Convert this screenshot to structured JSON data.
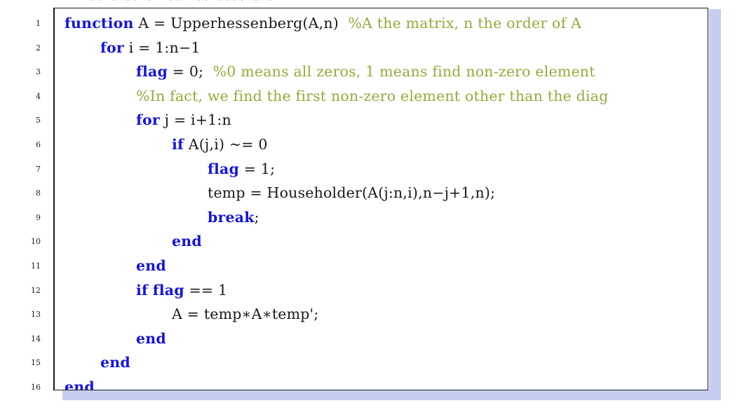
{
  "page": {
    "kind": "latex-code-listing",
    "language": "MATLAB",
    "clipped_top_text": ". , ; . , . , ; . , . . , ; . . , , . , , ; , . , . ,"
  },
  "colors": {
    "keyword": "#1414e0",
    "comment": "#9aa83c",
    "identifier": "#1a1a1a",
    "frame_border": "#1b1b1b",
    "shadow": "#c6cdf0",
    "background": "#ffffff"
  },
  "listing": {
    "line_numbers": [
      "1",
      "2",
      "3",
      "4",
      "5",
      "6",
      "7",
      "8",
      "9",
      "10",
      "11",
      "12",
      "13",
      "14",
      "15",
      "16"
    ],
    "lines": [
      {
        "number": "1",
        "indent": 0,
        "text": "function A = Upperhessenberg(A,n)  %A the matrix, n the order of A",
        "tokens": [
          {
            "t": "function",
            "k": "kw"
          },
          {
            "t": " A = Upperhessenberg(A,n)  ",
            "k": "id"
          },
          {
            "t": "%A the matrix, n the order of A",
            "k": "cm"
          }
        ]
      },
      {
        "number": "2",
        "indent": 2,
        "text": "for i = 1:n-1",
        "tokens": [
          {
            "t": "for",
            "k": "kw"
          },
          {
            "t": " i = 1:n−1",
            "k": "id"
          }
        ]
      },
      {
        "number": "3",
        "indent": 4,
        "text": "flag = 0;  %0 means all zeros, 1 means find non-zero element",
        "tokens": [
          {
            "t": "flag",
            "k": "kw"
          },
          {
            "t": " = 0;  ",
            "k": "id"
          },
          {
            "t": "%0 means all zeros, 1 means find non-zero element",
            "k": "cm"
          }
        ]
      },
      {
        "number": "4",
        "indent": 4,
        "text": "%In fact, we find the first non-zero element other than the diag",
        "tokens": [
          {
            "t": "%In fact, we find the first non-zero element other than the diag",
            "k": "cm"
          }
        ]
      },
      {
        "number": "5",
        "indent": 4,
        "text": "for j = i+1:n",
        "tokens": [
          {
            "t": "for",
            "k": "kw"
          },
          {
            "t": " j = i+1:n",
            "k": "id"
          }
        ]
      },
      {
        "number": "6",
        "indent": 6,
        "text": "if A(j,i) ~= 0",
        "tokens": [
          {
            "t": "if",
            "k": "kw"
          },
          {
            "t": " A(j,i) ~= 0",
            "k": "id"
          }
        ]
      },
      {
        "number": "7",
        "indent": 8,
        "text": "flag = 1;",
        "tokens": [
          {
            "t": "flag",
            "k": "kw"
          },
          {
            "t": " = 1;",
            "k": "id"
          }
        ]
      },
      {
        "number": "8",
        "indent": 8,
        "text": "temp = Householder(A(j:n,i),n-j+1,n);",
        "tokens": [
          {
            "t": "temp = Householder(A(j:n,i),n−j+1,n);",
            "k": "id"
          }
        ]
      },
      {
        "number": "9",
        "indent": 8,
        "text": "break;",
        "tokens": [
          {
            "t": "break",
            "k": "kw"
          },
          {
            "t": ";",
            "k": "id"
          }
        ]
      },
      {
        "number": "10",
        "indent": 6,
        "text": "end",
        "tokens": [
          {
            "t": "end",
            "k": "kw"
          }
        ]
      },
      {
        "number": "11",
        "indent": 4,
        "text": "end",
        "tokens": [
          {
            "t": "end",
            "k": "kw"
          }
        ]
      },
      {
        "number": "12",
        "indent": 4,
        "text": "if flag == 1",
        "tokens": [
          {
            "t": "if",
            "k": "kw"
          },
          {
            "t": " ",
            "k": "id"
          },
          {
            "t": "flag",
            "k": "kw"
          },
          {
            "t": " == 1",
            "k": "id"
          }
        ]
      },
      {
        "number": "13",
        "indent": 6,
        "text": "A = temp*A*temp';",
        "tokens": [
          {
            "t": "A = temp∗A∗temp';",
            "k": "id"
          }
        ]
      },
      {
        "number": "14",
        "indent": 4,
        "text": "end",
        "tokens": [
          {
            "t": "end",
            "k": "kw"
          }
        ]
      },
      {
        "number": "15",
        "indent": 2,
        "text": "end",
        "tokens": [
          {
            "t": "end",
            "k": "kw"
          }
        ]
      },
      {
        "number": "16",
        "indent": 0,
        "text": "end",
        "tokens": [
          {
            "t": "end",
            "k": "kw"
          }
        ]
      }
    ]
  }
}
